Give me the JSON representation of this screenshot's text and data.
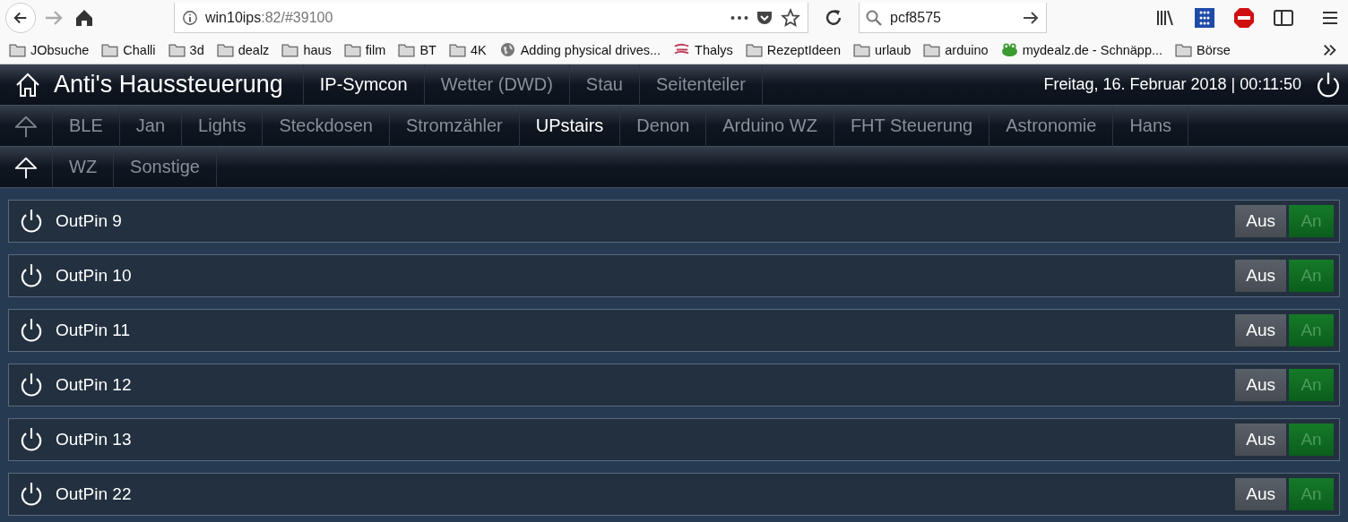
{
  "browser": {
    "url_host": "win10ips",
    "url_rest": ":82/#39100",
    "search": "pcf8575"
  },
  "bookmarks": [
    {
      "label": "JObsuche",
      "kind": "folder"
    },
    {
      "label": "Challi",
      "kind": "folder"
    },
    {
      "label": "3d",
      "kind": "folder"
    },
    {
      "label": "dealz",
      "kind": "folder"
    },
    {
      "label": "haus",
      "kind": "folder"
    },
    {
      "label": "film",
      "kind": "folder"
    },
    {
      "label": "BT",
      "kind": "folder"
    },
    {
      "label": "4K",
      "kind": "folder"
    },
    {
      "label": "Adding physical drives...",
      "kind": "globe"
    },
    {
      "label": "Thalys",
      "kind": "stripes"
    },
    {
      "label": "RezeptIdeen",
      "kind": "folder"
    },
    {
      "label": "urlaub",
      "kind": "folder"
    },
    {
      "label": "arduino",
      "kind": "folder"
    },
    {
      "label": "mydealz.de - Schnäpp...",
      "kind": "creature"
    },
    {
      "label": "Börse",
      "kind": "folder"
    }
  ],
  "header": {
    "title": "Anti's Haussteuerung",
    "datetime": "Freitag, 16. Februar 2018 | 00:11:50",
    "nav": [
      {
        "label": "IP-Symcon",
        "selected": true
      },
      {
        "label": "Wetter (DWD)",
        "selected": false
      },
      {
        "label": "Stau",
        "selected": false
      },
      {
        "label": "Seitenteiler",
        "selected": false
      }
    ]
  },
  "tab_bars": [
    {
      "back_enabled": false,
      "tabs": [
        {
          "label": "BLE",
          "selected": false
        },
        {
          "label": "Jan",
          "selected": false
        },
        {
          "label": "Lights",
          "selected": false
        },
        {
          "label": "Steckdosen",
          "selected": false
        },
        {
          "label": "Stromzähler",
          "selected": false
        },
        {
          "label": "UPstairs",
          "selected": true
        },
        {
          "label": "Denon",
          "selected": false
        },
        {
          "label": "Arduino WZ",
          "selected": false
        },
        {
          "label": "FHT Steuerung",
          "selected": false
        },
        {
          "label": "Astronomie",
          "selected": false
        },
        {
          "label": "Hans",
          "selected": false
        }
      ]
    },
    {
      "back_enabled": true,
      "tabs": [
        {
          "label": "WZ",
          "selected": false
        },
        {
          "label": "Sonstige",
          "selected": false
        }
      ]
    }
  ],
  "rows": [
    {
      "name": "OutPin 9",
      "buttons": [
        {
          "label": "Aus",
          "kind": "off",
          "selected": true
        },
        {
          "label": "An",
          "kind": "on",
          "selected": false
        }
      ]
    },
    {
      "name": "OutPin 10",
      "buttons": [
        {
          "label": "Aus",
          "kind": "off",
          "selected": true
        },
        {
          "label": "An",
          "kind": "on",
          "selected": false
        }
      ]
    },
    {
      "name": "OutPin 11",
      "buttons": [
        {
          "label": "Aus",
          "kind": "off",
          "selected": true
        },
        {
          "label": "An",
          "kind": "on",
          "selected": false
        }
      ]
    },
    {
      "name": "OutPin 12",
      "buttons": [
        {
          "label": "Aus",
          "kind": "off",
          "selected": true
        },
        {
          "label": "An",
          "kind": "on",
          "selected": false
        }
      ]
    },
    {
      "name": "OutPin 13",
      "buttons": [
        {
          "label": "Aus",
          "kind": "off",
          "selected": true
        },
        {
          "label": "An",
          "kind": "on",
          "selected": false
        }
      ]
    },
    {
      "name": "OutPin 22",
      "buttons": [
        {
          "label": "Aus",
          "kind": "off",
          "selected": true
        },
        {
          "label": "An",
          "kind": "on",
          "selected": false
        }
      ]
    }
  ]
}
